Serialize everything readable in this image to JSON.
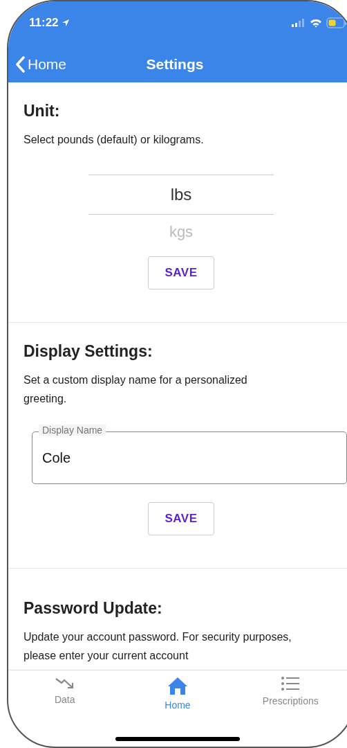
{
  "status_bar": {
    "time": "11:22"
  },
  "nav": {
    "back": "Home",
    "title": "Settings"
  },
  "sections": [
    {
      "kind": "picker",
      "heading": "Unit:",
      "description": "Select pounds (default) or kilograms.",
      "options": [
        {
          "label": "lbs",
          "selected": true
        },
        {
          "label": "kgs",
          "selected": false
        }
      ],
      "button": "SAVE"
    },
    {
      "kind": "field",
      "heading": "Display Settings:",
      "description": "Set a custom display name for a personalized greeting.",
      "field": {
        "label": "Display Name",
        "value": "Cole"
      },
      "button": "SAVE"
    },
    {
      "kind": "text",
      "heading": "Password Update:",
      "description": "Update your account password. For security purposes, please enter your current account"
    }
  ],
  "tabs": [
    {
      "label": "Data",
      "selected": false
    },
    {
      "label": "Home",
      "selected": true
    },
    {
      "label": "Prescriptions",
      "selected": false
    }
  ]
}
